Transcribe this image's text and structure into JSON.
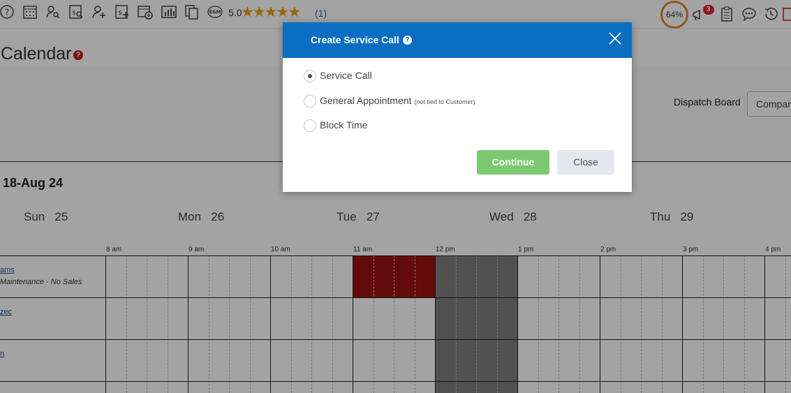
{
  "toolbar": {
    "icons": [
      "help-icon",
      "calendar-icon",
      "customer-search-icon",
      "invoice-search-icon",
      "add-customer-icon",
      "add-invoice-icon",
      "add-appointment-icon",
      "reports-icon",
      "documents-icon",
      "esm-icon"
    ],
    "esm_label": "ESM",
    "rating": "5.0",
    "stars": "★★★★★",
    "review_count": "(1)",
    "progress": "64%",
    "notification_count": "3"
  },
  "page": {
    "title": "Calendar",
    "help": "?"
  },
  "filters": {
    "dispatch_label": "Dispatch Board",
    "company_value": "Company"
  },
  "calendar": {
    "date_range": "18-Aug 24",
    "days": [
      {
        "name": "Sun",
        "num": "25"
      },
      {
        "name": "Mon",
        "num": "26"
      },
      {
        "name": "Tue",
        "num": "27"
      },
      {
        "name": "Wed",
        "num": "28"
      },
      {
        "name": "Thu",
        "num": "29"
      }
    ],
    "times": [
      "8 am",
      "9 am",
      "10 am",
      "11 am",
      "12 pm",
      "1 pm",
      "2 pm",
      "3 pm",
      "4 pm"
    ],
    "technicians": [
      {
        "name": "ams",
        "sub": "Maintenance - No Sales"
      },
      {
        "name": "zec",
        "sub": ""
      },
      {
        "name": "n",
        "sub": ""
      }
    ]
  },
  "modal": {
    "title": "Create Service Call",
    "help": "?",
    "options": [
      {
        "label": "Service Call",
        "note": "",
        "selected": true
      },
      {
        "label": "General Appointment",
        "note": "(not tied to Customer)",
        "selected": false
      },
      {
        "label": "Block Time",
        "note": "",
        "selected": false
      }
    ],
    "continue_label": "Continue",
    "close_label": "Close"
  },
  "colors": {
    "header_blue": "#0a6fc2",
    "continue_green": "#7bc96f",
    "star_gold": "#e8a317",
    "event_red": "#9b1212"
  }
}
